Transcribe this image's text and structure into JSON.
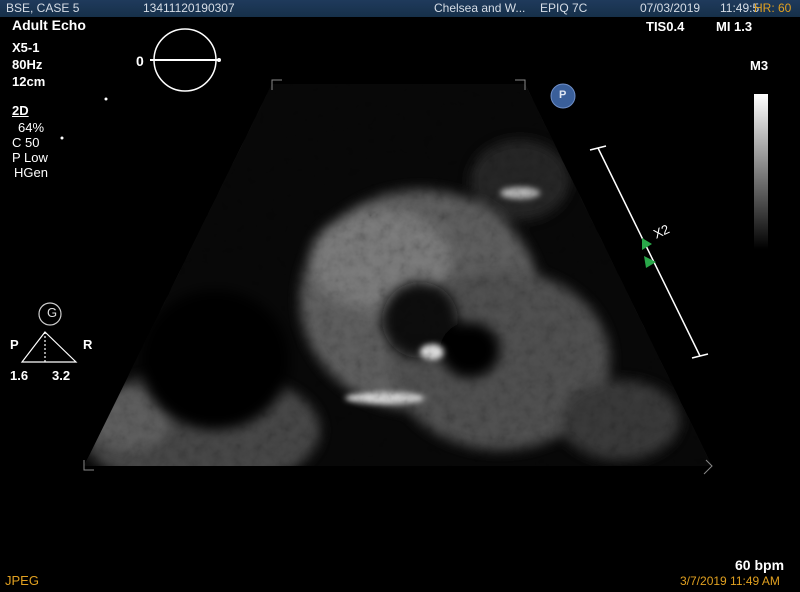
{
  "topbar": {
    "patient": "BSE, CASE 5",
    "patient_id": "13411120190307",
    "institution": "Chelsea and W...",
    "system": "EPIQ 7C",
    "date": "07/03/2019",
    "time": "11:49:5",
    "heart_rate": "HR: 60"
  },
  "left_params": {
    "preset": "Adult Echo",
    "probe": "X5-1",
    "frame_rate": "80Hz",
    "depth": "12cm",
    "mode": "2D",
    "gain": "64%",
    "compression": "C 50",
    "power": "P Low",
    "harmonics": "HGen"
  },
  "right_params": {
    "tis": "TIS0.4",
    "mi": "MI 1.3",
    "map": "M3"
  },
  "orientation": {
    "zero_label": "0",
    "p_badge": "P"
  },
  "xplane": {
    "g_badge": "G",
    "left_label": "P",
    "right_label": "R",
    "value_left": "1.6",
    "value_right": "3.2"
  },
  "scale": {
    "label": "X2"
  },
  "bottom": {
    "heart_rate_bpm": "60 bpm",
    "format": "JPEG",
    "datetime": "3/7/2019 11:49 AM"
  },
  "colors": {
    "topbar": "#1f3a5c",
    "orange_text": "#e0a020",
    "marker_green": "#2aa84a",
    "p_badge": "#3a5f9a"
  }
}
